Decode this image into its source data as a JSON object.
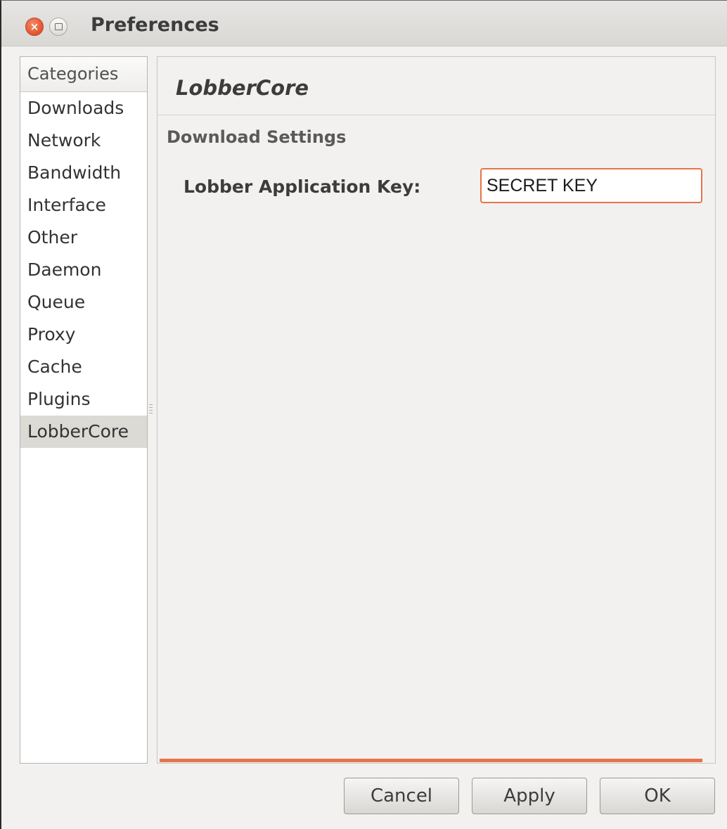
{
  "window": {
    "title": "Preferences",
    "close_glyph": "×"
  },
  "sidebar": {
    "header": "Categories",
    "items": [
      {
        "label": "Downloads"
      },
      {
        "label": "Network"
      },
      {
        "label": "Bandwidth"
      },
      {
        "label": "Interface"
      },
      {
        "label": "Other"
      },
      {
        "label": "Daemon"
      },
      {
        "label": "Queue"
      },
      {
        "label": "Proxy"
      },
      {
        "label": "Cache"
      },
      {
        "label": "Plugins"
      },
      {
        "label": "LobberCore"
      }
    ],
    "selected": "LobberCore"
  },
  "panel": {
    "title": "LobberCore",
    "section": "Download Settings",
    "field_label": "Lobber Application Key:",
    "field_value": "SECRET KEY"
  },
  "buttons": {
    "cancel": "Cancel",
    "apply": "Apply",
    "ok": "OK"
  },
  "colors": {
    "accent": "#e8734a",
    "close_button": "#e2532b",
    "selection": "#dcdad5"
  },
  "icons": {
    "close": "close-icon",
    "maximize": "maximize-icon"
  }
}
